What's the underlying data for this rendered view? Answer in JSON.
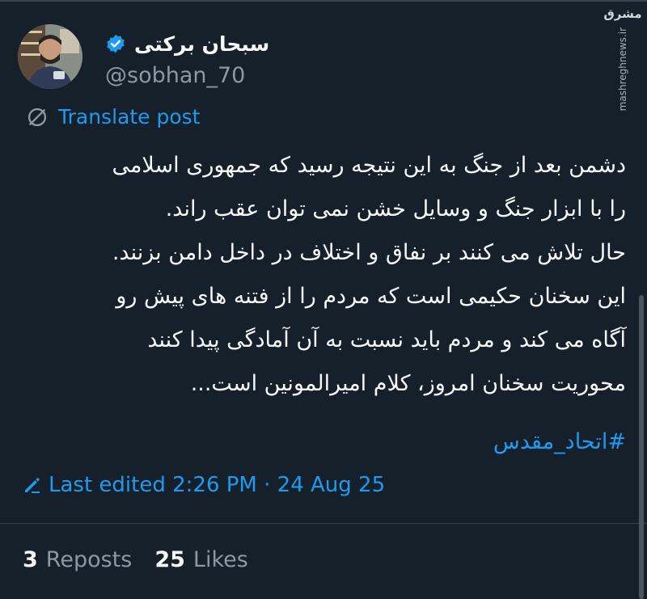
{
  "author": {
    "display_name": "سبحان برکتی",
    "handle": "@sobhan_70",
    "avatar_icon": "person-with-phone-avatar",
    "verified_icon": "verified-badge-icon"
  },
  "translate": {
    "label": "Translate post",
    "icon": "translate-globe-icon"
  },
  "post": {
    "lines": [
      "دشمن بعد از جنگ به این نتیجه رسید که جمهوری اسلامی",
      "را با ابزار جنگ و وسایل خشن نمی توان عقب راند.",
      "حال تلاش می کنند بر نفاق و اختلاف در داخل دامن بزنند.",
      "این سخنان حکیمی است که مردم را از فتنه های پیش رو",
      "آگاه می کند و مردم باید نسبت به آن آمادگی پیدا کنند",
      "محوریت سخنان امروز، کلام امیرالمونین است..."
    ],
    "hashtag": "#اتحاد_مقدس"
  },
  "meta": {
    "edited": "Last edited 2:26 PM · 24 Aug 25",
    "edit_icon": "pencil-icon"
  },
  "stats": {
    "reposts_count": "3",
    "reposts_label": "Reposts",
    "likes_count": "25",
    "likes_label": "Likes"
  },
  "watermark": {
    "logo": "مشرق",
    "site": "mashreghnews.ir"
  },
  "colors": {
    "background": "#15202b",
    "accent": "#1d9bf0",
    "muted": "#8b98a5",
    "text": "#f7f9f9"
  }
}
